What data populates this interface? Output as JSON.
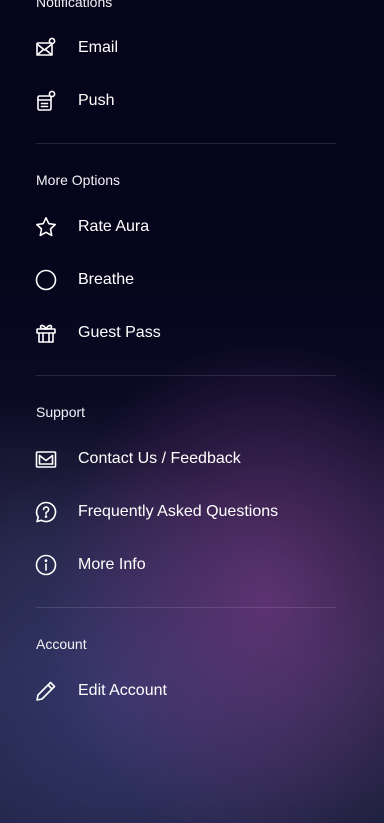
{
  "sections": {
    "notifications": {
      "title": "Notifications",
      "items": [
        {
          "label": "Email",
          "icon": "email-notification-icon"
        },
        {
          "label": "Push",
          "icon": "push-notification-icon"
        }
      ]
    },
    "more_options": {
      "title": "More Options",
      "items": [
        {
          "label": "Rate Aura",
          "icon": "star-icon"
        },
        {
          "label": "Breathe",
          "icon": "circle-icon"
        },
        {
          "label": "Guest Pass",
          "icon": "gift-icon"
        }
      ]
    },
    "support": {
      "title": "Support",
      "items": [
        {
          "label": "Contact Us / Feedback",
          "icon": "mail-icon"
        },
        {
          "label": "Frequently Asked Questions",
          "icon": "question-bubble-icon"
        },
        {
          "label": "More Info",
          "icon": "info-icon"
        }
      ]
    },
    "account": {
      "title": "Account",
      "items": [
        {
          "label": "Edit Account",
          "icon": "pencil-icon"
        }
      ]
    }
  },
  "colors": {
    "text": "#ffffff",
    "background_top": "#06041a",
    "glow_purple": "#6e377d",
    "glow_blue": "#373e78"
  }
}
